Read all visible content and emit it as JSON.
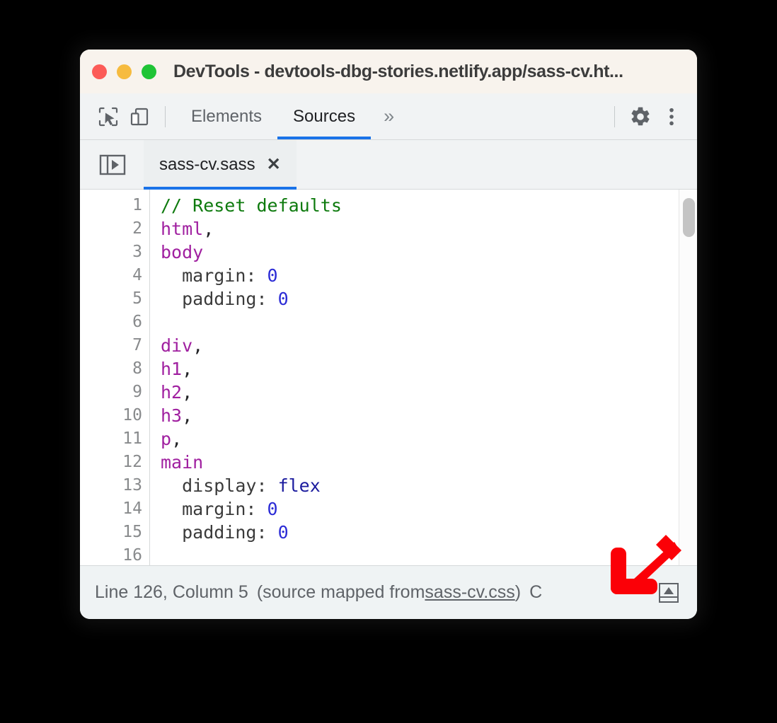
{
  "window": {
    "title": "DevTools - devtools-dbg-stories.netlify.app/sass-cv.ht...",
    "traffic_lights": [
      {
        "name": "close",
        "color": "#fc5b57"
      },
      {
        "name": "minimize",
        "color": "#f6bb3f"
      },
      {
        "name": "maximize",
        "color": "#1fc436"
      }
    ]
  },
  "toolbar": {
    "inspect_icon": "inspect-element-icon",
    "device_icon": "device-toolbar-icon",
    "tabs": [
      {
        "label": "Elements",
        "active": false
      },
      {
        "label": "Sources",
        "active": true
      }
    ],
    "more_tabs_label": "»",
    "settings_icon": "gear-icon",
    "menu_icon": "kebab-menu-icon"
  },
  "filestrip": {
    "navigator_toggle_icon": "show-navigator-icon",
    "open_file": {
      "name": "sass-cv.sass",
      "close_label": "✕"
    }
  },
  "editor": {
    "line_numbers": [
      1,
      2,
      3,
      4,
      5,
      6,
      7,
      8,
      9,
      10,
      11,
      12,
      13,
      14,
      15,
      16
    ],
    "lines": [
      {
        "n": 1,
        "tokens": [
          {
            "t": "// Reset defaults",
            "c": "tok-comment"
          }
        ]
      },
      {
        "n": 2,
        "tokens": [
          {
            "t": "html",
            "c": "tok-tag"
          },
          {
            "t": ",",
            "c": "tok-punct"
          }
        ]
      },
      {
        "n": 3,
        "tokens": [
          {
            "t": "body",
            "c": "tok-tag"
          }
        ]
      },
      {
        "n": 4,
        "tokens": [
          {
            "t": "  margin: ",
            "c": "tok-prop"
          },
          {
            "t": "0",
            "c": "tok-num"
          }
        ]
      },
      {
        "n": 5,
        "tokens": [
          {
            "t": "  padding: ",
            "c": "tok-prop"
          },
          {
            "t": "0",
            "c": "tok-num"
          }
        ]
      },
      {
        "n": 6,
        "tokens": [
          {
            "t": "",
            "c": "tok-plain"
          }
        ]
      },
      {
        "n": 7,
        "tokens": [
          {
            "t": "div",
            "c": "tok-tag"
          },
          {
            "t": ",",
            "c": "tok-punct"
          }
        ]
      },
      {
        "n": 8,
        "tokens": [
          {
            "t": "h1",
            "c": "tok-tag"
          },
          {
            "t": ",",
            "c": "tok-punct"
          }
        ]
      },
      {
        "n": 9,
        "tokens": [
          {
            "t": "h2",
            "c": "tok-tag"
          },
          {
            "t": ",",
            "c": "tok-punct"
          }
        ]
      },
      {
        "n": 10,
        "tokens": [
          {
            "t": "h3",
            "c": "tok-tag"
          },
          {
            "t": ",",
            "c": "tok-punct"
          }
        ]
      },
      {
        "n": 11,
        "tokens": [
          {
            "t": "p",
            "c": "tok-tag"
          },
          {
            "t": ",",
            "c": "tok-punct"
          }
        ]
      },
      {
        "n": 12,
        "tokens": [
          {
            "t": "main",
            "c": "tok-tag"
          }
        ]
      },
      {
        "n": 13,
        "tokens": [
          {
            "t": "  display: ",
            "c": "tok-prop"
          },
          {
            "t": "flex",
            "c": "tok-value"
          }
        ]
      },
      {
        "n": 14,
        "tokens": [
          {
            "t": "  margin: ",
            "c": "tok-prop"
          },
          {
            "t": "0",
            "c": "tok-num"
          }
        ]
      },
      {
        "n": 15,
        "tokens": [
          {
            "t": "  padding: ",
            "c": "tok-prop"
          },
          {
            "t": "0",
            "c": "tok-num"
          }
        ]
      },
      {
        "n": 16,
        "tokens": [
          {
            "t": "",
            "c": "tok-plain"
          }
        ]
      }
    ],
    "scrollbar": {
      "name": "vertical-scrollbar"
    }
  },
  "statusbar": {
    "position_text": "Line 126, Column 5",
    "source_map_prefix": "(source mapped from ",
    "source_map_link": "sass-cv.css",
    "source_map_suffix": ")",
    "trailing_text": "C",
    "pretty_print_icon": "pretty-print-icon"
  },
  "annotation": {
    "arrow_color": "#fb0007",
    "arrow_direction": "down-left"
  },
  "colors": {
    "accent_blue": "#1a73e8",
    "titlebar_bg": "#f8f3ec",
    "toolbar_bg": "#f1f3f4",
    "statusbar_bg": "#eff3f4",
    "comment_green": "#0d7a0d",
    "tag_purple": "#a020a0",
    "number_blue": "#2c2cd6",
    "value_navy": "#1b1b9e"
  }
}
